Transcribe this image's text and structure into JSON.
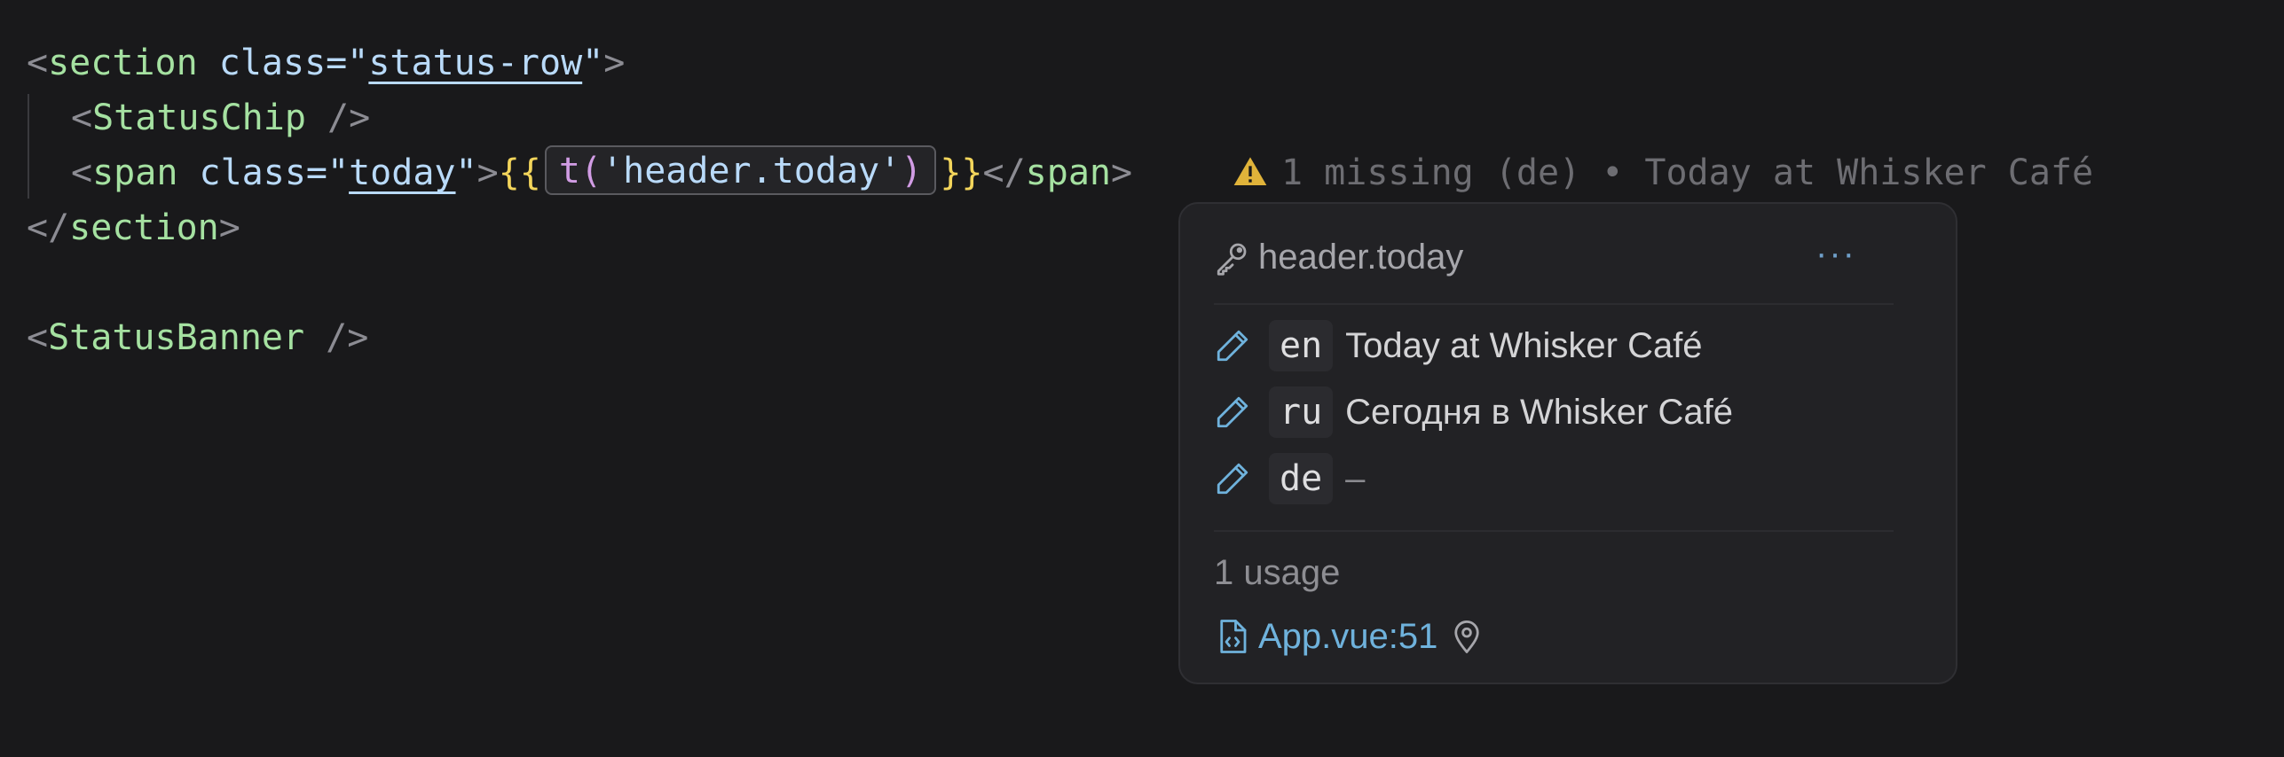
{
  "editor": {
    "line1": {
      "open": "<",
      "tag": "section",
      "attr": " class=",
      "quote_open": "\"",
      "value": "status-row",
      "quote_close": "\"",
      "close": ">"
    },
    "line2": {
      "open": "<",
      "tag": "StatusChip",
      "close": " />"
    },
    "line3": {
      "open": "<",
      "tag": "span",
      "attr": " class=",
      "quote_open": "\"",
      "value": "today",
      "quote_close": "\"",
      "close": ">",
      "brace_open": "{{",
      "fn": "t",
      "paren_open": "(",
      "arg": "'header.today'",
      "paren_close": ")",
      "brace_close": "}}",
      "end_open": "</",
      "end_tag": "span",
      "end_close": ">"
    },
    "line4": {
      "open": "</",
      "tag": "section",
      "close": ">"
    },
    "line5": {
      "open": "<",
      "tag": "StatusBanner",
      "close": " />"
    },
    "inline_hint": "1 missing (de) • Today at Whisker Café"
  },
  "popover": {
    "key": "header.today",
    "more": "···",
    "translations": [
      {
        "lang": "en",
        "value": "Today at Whisker Café"
      },
      {
        "lang": "ru",
        "value": "Сегодня в Whisker Café"
      },
      {
        "lang": "de",
        "value": "–"
      }
    ],
    "usage_count": "1 usage",
    "file_ref": "App.vue:51"
  },
  "colors": {
    "background": "#19191b",
    "tag": "#a5e1a1",
    "attr": "#b9daf9",
    "brace": "#f3d55b",
    "fn": "#d19ce4",
    "warning": "#e0b33a",
    "link": "#6fb2dc"
  },
  "icons": {
    "warning": "warning-icon",
    "key": "key-icon",
    "edit": "pencil-icon",
    "file": "file-code-icon",
    "location": "location-pin-icon"
  }
}
